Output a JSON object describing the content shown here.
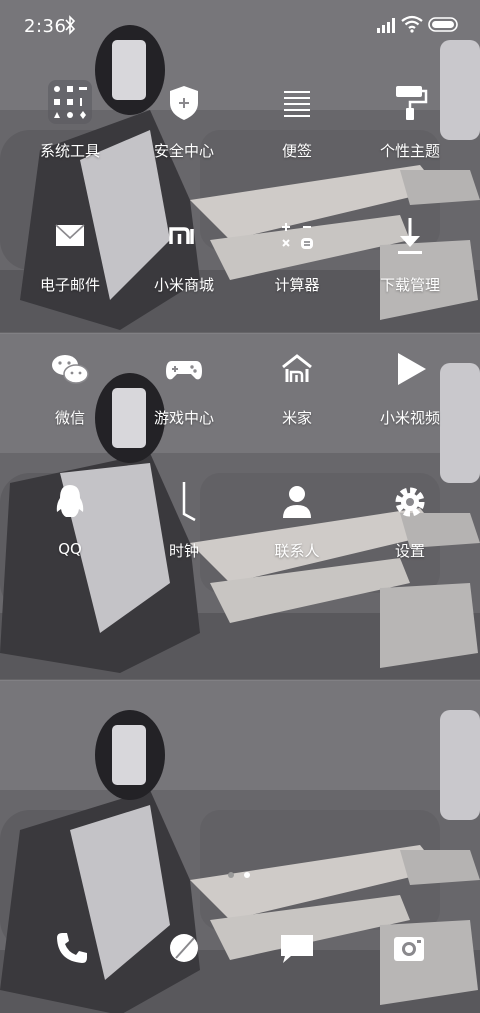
{
  "status_bar": {
    "time": "2:36",
    "icons": [
      "bluetooth-icon",
      "signal-icon",
      "wifi-icon",
      "battery-icon"
    ]
  },
  "pages": [
    {
      "apps": [
        {
          "label": "系统工具",
          "icon": "folder-icon"
        },
        {
          "label": "安全中心",
          "icon": "shield-plus-icon"
        },
        {
          "label": "便签",
          "icon": "notes-icon"
        },
        {
          "label": "个性主题",
          "icon": "paint-roller-icon"
        },
        {
          "label": "电子邮件",
          "icon": "mail-icon"
        },
        {
          "label": "小米商城",
          "icon": "mi-logo-icon"
        },
        {
          "label": "计算器",
          "icon": "calculator-icon"
        },
        {
          "label": "下载管理",
          "icon": "download-icon"
        }
      ]
    },
    {
      "apps": [
        {
          "label": "微信",
          "icon": "wechat-icon"
        },
        {
          "label": "游戏中心",
          "icon": "gamepad-icon"
        },
        {
          "label": "米家",
          "icon": "home-icon"
        },
        {
          "label": "小米视频",
          "icon": "play-icon"
        },
        {
          "label": "QQ",
          "icon": "qq-penguin-icon"
        },
        {
          "label": "时钟",
          "icon": "clock-icon"
        },
        {
          "label": "联系人",
          "icon": "person-icon"
        },
        {
          "label": "设置",
          "icon": "gear-icon"
        }
      ]
    }
  ],
  "page_indicator": {
    "count": 2,
    "current": 2
  },
  "dock": [
    "phone-icon",
    "browser-icon",
    "messages-icon",
    "camera-icon"
  ],
  "colors": {
    "icon": "#ffffff",
    "dot_active": "#ffffff",
    "dot_inactive": "#9a9a9a"
  }
}
